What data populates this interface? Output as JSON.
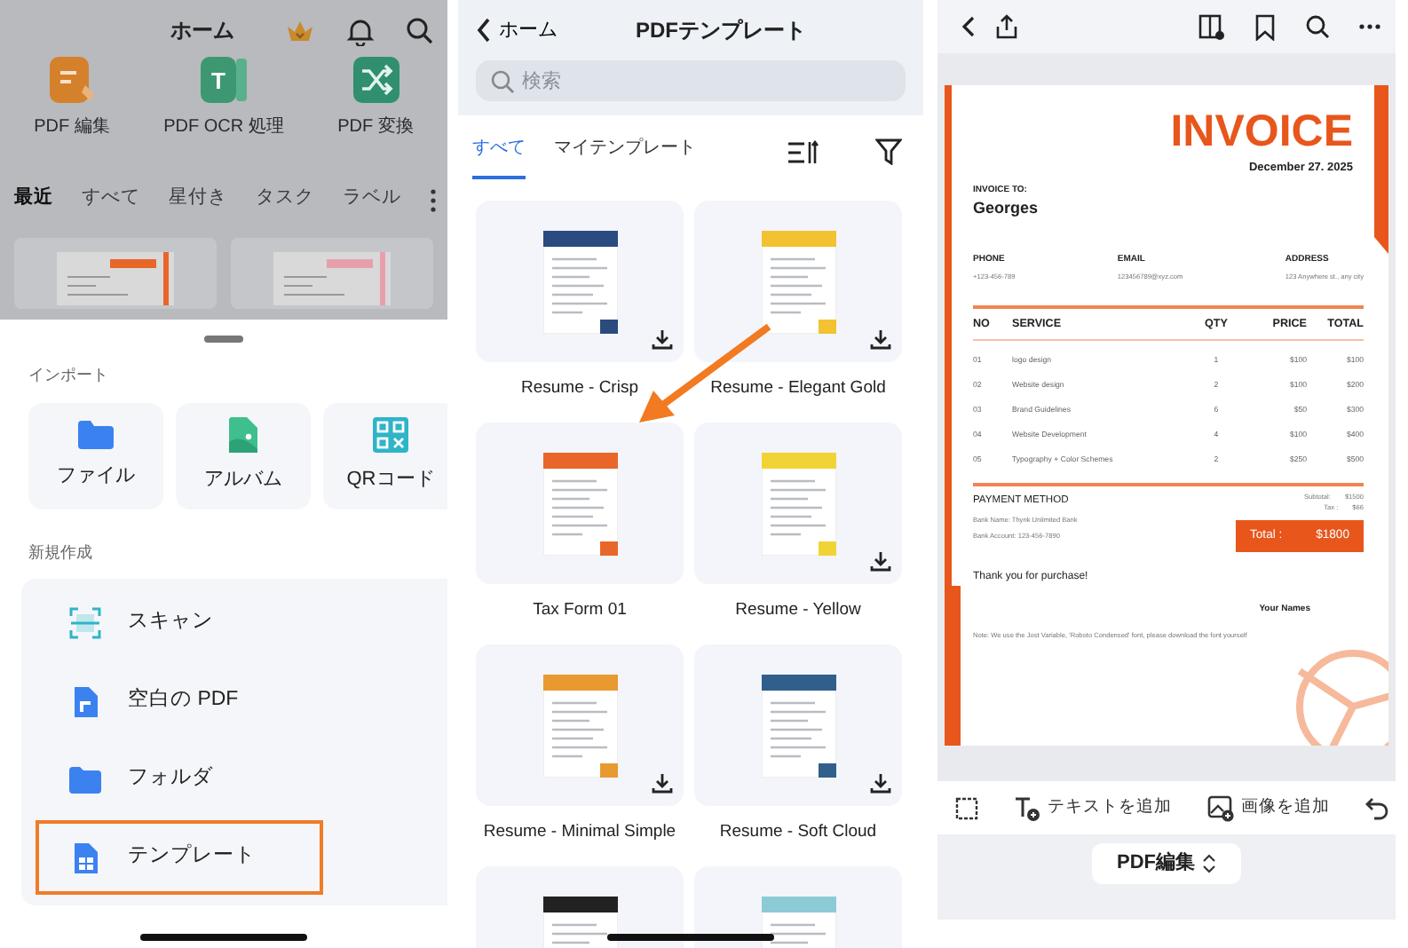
{
  "home_screen": {
    "title": "ホーム",
    "tools": [
      {
        "label": "PDF 編集",
        "kind": "edit"
      },
      {
        "label": "PDF OCR 処理",
        "kind": "ocr",
        "icon_text": "T"
      },
      {
        "label": "PDF 変換",
        "kind": "convert"
      }
    ],
    "tabs": [
      {
        "label": "最近",
        "selected": true
      },
      {
        "label": "すべて",
        "selected": false
      },
      {
        "label": "星付き",
        "selected": false
      },
      {
        "label": "タスク",
        "selected": false
      },
      {
        "label": "ラベル",
        "selected": false
      }
    ],
    "recent_files": [
      {
        "color": "#e8662a"
      },
      {
        "color": "#e6a0ac"
      }
    ],
    "sheet": {
      "import_heading": "インポート",
      "import_options": [
        {
          "label": "ファイル",
          "kind": "file"
        },
        {
          "label": "アルバム",
          "kind": "album"
        },
        {
          "label": "QRコード",
          "kind": "qr"
        }
      ],
      "create_heading": "新規作成",
      "create_options": [
        {
          "label": "スキャン",
          "kind": "scan",
          "highlighted": false
        },
        {
          "label": "空白の PDF",
          "kind": "blank",
          "highlighted": false
        },
        {
          "label": "フォルダ",
          "kind": "folder",
          "highlighted": false
        },
        {
          "label": "テンプレート",
          "kind": "template",
          "highlighted": true
        }
      ]
    }
  },
  "template_screen": {
    "back_label": "ホーム",
    "title": "PDFテンプレート",
    "search": {
      "placeholder": "検索"
    },
    "tabs": [
      {
        "label": "すべて",
        "selected": true
      },
      {
        "label": "マイテンプレート",
        "selected": false
      }
    ],
    "templates": [
      {
        "name": "Resume - Crisp",
        "color": "#2b4a80",
        "downloadable": true
      },
      {
        "name": "Resume - Elegant Gold",
        "color": "#f2c230",
        "downloadable": true
      },
      {
        "name": "Tax Form 01",
        "color": "#e8662a",
        "downloadable": false
      },
      {
        "name": "Resume - Yellow",
        "color": "#f2d335",
        "downloadable": true
      },
      {
        "name": "Resume - Minimal Simple",
        "color": "#e89a30",
        "downloadable": true
      },
      {
        "name": "Resume - Soft Cloud",
        "color": "#2f5f8a",
        "downloadable": true
      },
      {
        "color": "#222222"
      },
      {
        "color": "#8ccbd6"
      }
    ]
  },
  "editor_screen": {
    "invoice": {
      "title": "INVOICE",
      "date": "December 27. 2025",
      "to_label": "INVOICE TO:",
      "client": "Georges",
      "contacts": [
        {
          "label": "PHONE",
          "value": "+123-456-789"
        },
        {
          "label": "EMAIL",
          "value": "123456789@xyz.com"
        },
        {
          "label": "ADDRESS",
          "value": "123 Anywhere st., any city"
        }
      ],
      "columns": [
        "NO",
        "SERVICE",
        "QTY",
        "PRICE",
        "TOTAL"
      ],
      "rows": [
        [
          "01",
          "logo design",
          "1",
          "$100",
          "$100"
        ],
        [
          "02",
          "Website design",
          "2",
          "$100",
          "$200"
        ],
        [
          "03",
          "Brand Guidelines",
          "6",
          "$50",
          "$300"
        ],
        [
          "04",
          "Website Development",
          "4",
          "$100",
          "$400"
        ],
        [
          "05",
          "Typography + Color Schemes",
          "2",
          "$250",
          "$500"
        ]
      ],
      "payment_heading": "PAYMENT METHOD",
      "payment_lines": [
        "Bank Name: Thynk Unlimited Bank",
        "Bank Account: 123-456-7890"
      ],
      "summary": [
        {
          "label": "Subtotal:",
          "value": "$1500"
        },
        {
          "label": "Tax :",
          "value": "$66"
        }
      ],
      "total": {
        "label": "Total :",
        "value": "$1800"
      },
      "thanks": "Thank you for purchase!",
      "signature": "Your Names",
      "note": "Note: We use the Jost Variable, 'Roboto Condensed' font, please download the font yourself"
    },
    "bottom_tools": [
      {
        "label": "テキストを追加",
        "kind": "text"
      },
      {
        "label": "画像を追加",
        "kind": "image"
      }
    ],
    "mode_button": "PDF編集"
  }
}
